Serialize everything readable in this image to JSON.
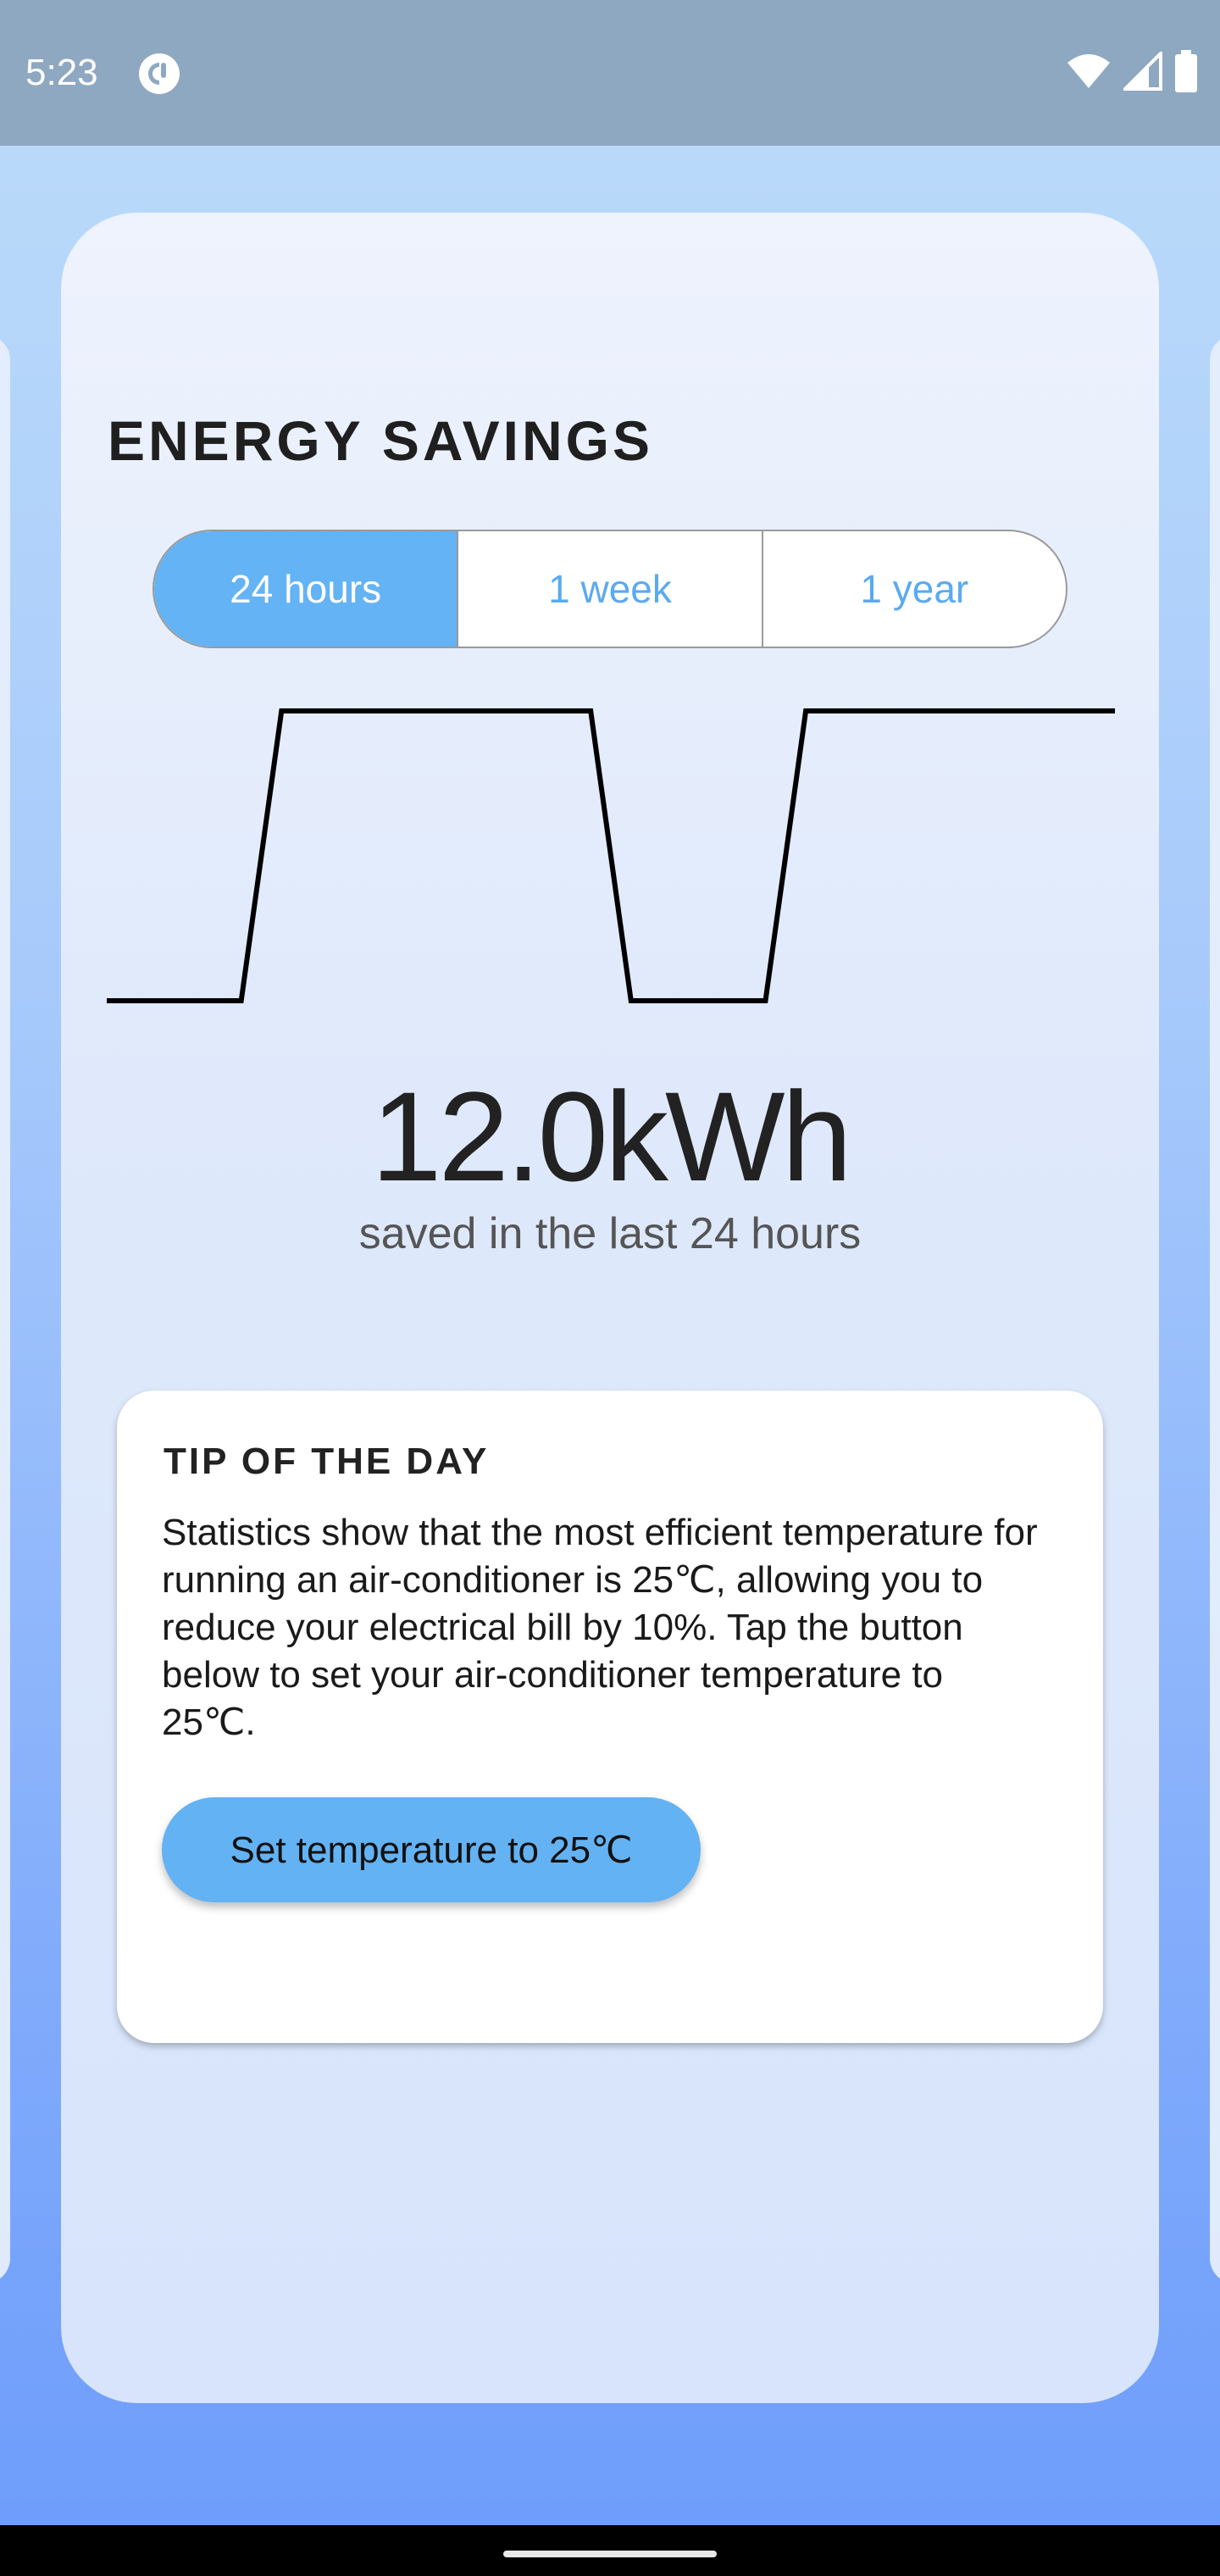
{
  "status_bar": {
    "time": "5:23",
    "app_icon": "pocket-casts-icon",
    "icons": [
      "wifi-icon",
      "cellular-signal-icon",
      "battery-icon"
    ]
  },
  "card": {
    "title": "ENERGY SAVINGS",
    "tabs": [
      {
        "label": "24 hours",
        "selected": true
      },
      {
        "label": "1 week",
        "selected": false
      },
      {
        "label": "1 year",
        "selected": false
      }
    ],
    "savings_value": "12.0kWh",
    "savings_caption": "saved in the last 24 hours"
  },
  "chart_data": {
    "type": "line",
    "x": [
      0,
      1,
      1.3,
      3.6,
      3.9,
      4.9,
      5.2,
      7.5
    ],
    "values": [
      0,
      0,
      1,
      1,
      0,
      0,
      1,
      1
    ],
    "title": "",
    "xlabel": "",
    "ylabel": "",
    "grid": false
  },
  "tip": {
    "title": "TIP OF THE DAY",
    "body": "Statistics show that the most efficient temperature for running an air-conditioner is 25℃, allowing you to reduce your electrical bill by 10%. Tap the button below to set your air-conditioner temperature to 25℃.",
    "button_label": "Set temperature to 25℃"
  },
  "colors": {
    "accent": "#64b3f4",
    "tab_text": "#5aaaf0"
  }
}
